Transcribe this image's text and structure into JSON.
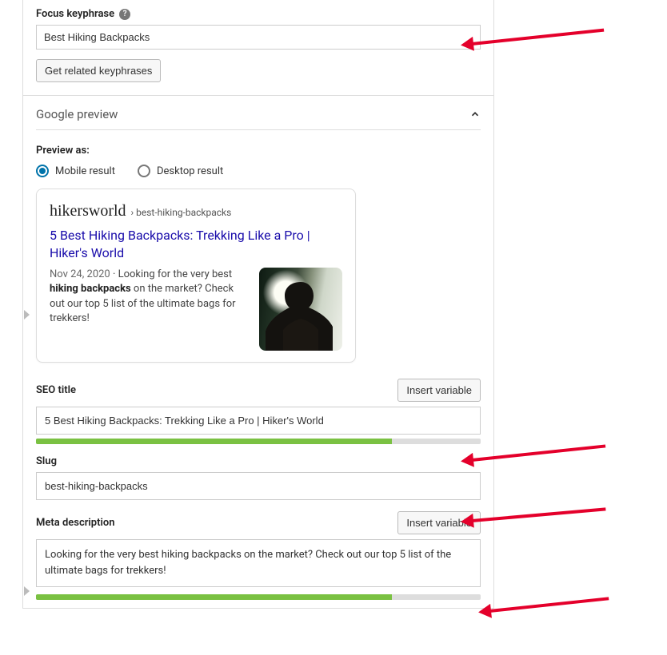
{
  "focus": {
    "label": "Focus keyphrase",
    "value": "Best Hiking Backpacks",
    "related_btn": "Get related keyphrases"
  },
  "google_preview": {
    "title": "Google preview",
    "preview_as_label": "Preview as:",
    "radios": {
      "mobile": "Mobile result",
      "desktop": "Desktop result"
    }
  },
  "serp": {
    "domain": "hikersworld",
    "path": "› best-hiking-backpacks",
    "title": "5 Best Hiking Backpacks: Trekking Like a Pro | Hiker's World",
    "date": "Nov 24, 2020",
    "desc_pre": " · Looking for the very best ",
    "desc_bold": "hiking backpacks",
    "desc_post": " on the market? Check out our top 5 list of the ultimate bags for trekkers!"
  },
  "fields": {
    "seo_title": {
      "label": "SEO title",
      "value": "5 Best Hiking Backpacks: Trekking Like a Pro | Hiker's World",
      "insert": "Insert variable",
      "progress_pct": 80
    },
    "slug": {
      "label": "Slug",
      "value": "best-hiking-backpacks"
    },
    "meta": {
      "label": "Meta description",
      "value": "Looking for the very best hiking backpacks on the market? Check out our top 5 list of the ultimate bags for trekkers!",
      "insert": "Insert variable",
      "progress_pct": 80
    }
  }
}
